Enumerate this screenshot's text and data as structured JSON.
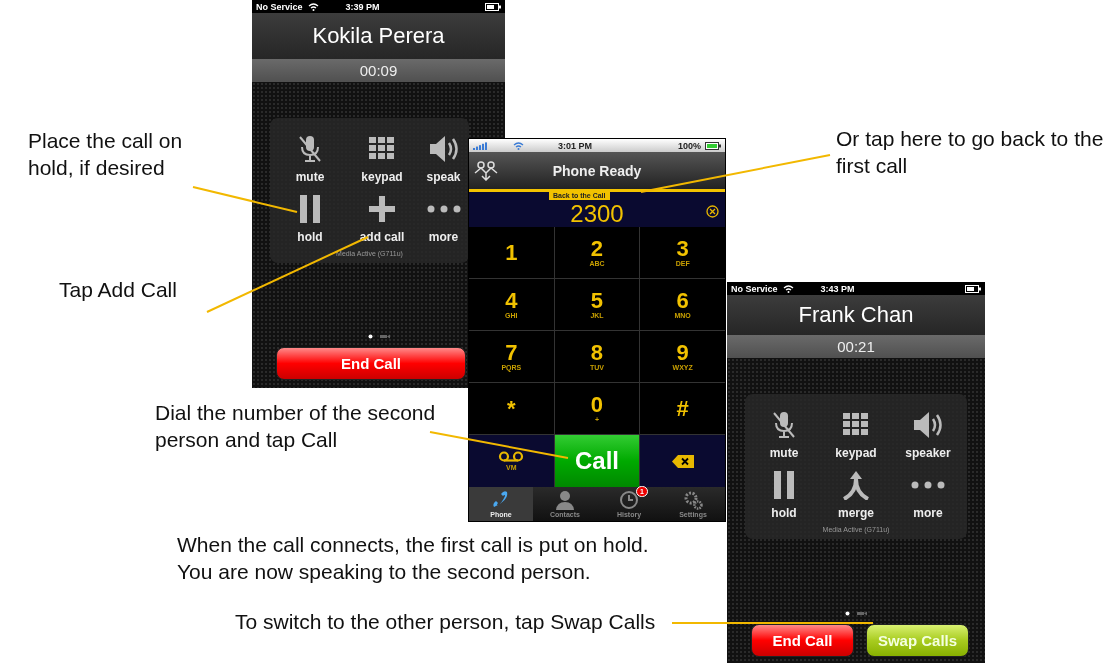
{
  "call_screen_first": {
    "carrier": "No Service",
    "time": "3:39 PM",
    "caller": "Kokila Perera",
    "duration": "00:09",
    "controls": [
      {
        "kind": "mute",
        "label": "mute"
      },
      {
        "kind": "keypad",
        "label": "keypad"
      },
      {
        "kind": "speaker",
        "label": "speak"
      },
      {
        "kind": "hold",
        "label": "hold"
      },
      {
        "kind": "add",
        "label": "add call"
      },
      {
        "kind": "more",
        "label": "more"
      }
    ],
    "media": "Media Active (G711u)",
    "actions": [
      {
        "kind": "end",
        "label": "End Call"
      }
    ]
  },
  "dialer": {
    "time": "3:01 PM",
    "battery": "100%",
    "title": "Phone Ready",
    "banner": "Back to the Call",
    "number": "2300",
    "keys": [
      {
        "digit": "1"
      },
      {
        "digit": "2",
        "letters": "ABC"
      },
      {
        "digit": "3",
        "letters": "DEF"
      },
      {
        "digit": "4",
        "letters": "GHI"
      },
      {
        "digit": "5",
        "letters": "JKL"
      },
      {
        "digit": "6",
        "letters": "MNO"
      },
      {
        "digit": "7",
        "letters": "PQRS"
      },
      {
        "digit": "8",
        "letters": "TUV"
      },
      {
        "digit": "9",
        "letters": "WXYZ"
      },
      {
        "digit": "*"
      },
      {
        "digit": "0",
        "letters": "+"
      },
      {
        "digit": "#"
      }
    ],
    "bottom_row": [
      {
        "kind": "voicemail",
        "label": "VM"
      },
      {
        "kind": "call",
        "label": "Call"
      },
      {
        "kind": "backspace"
      }
    ],
    "tabs": [
      {
        "kind": "phone",
        "label": "Phone",
        "selected": true
      },
      {
        "kind": "contacts",
        "label": "Contacts",
        "selected": false
      },
      {
        "kind": "history",
        "label": "History",
        "selected": false,
        "badge": "1"
      },
      {
        "kind": "settings",
        "label": "Settings",
        "selected": false
      }
    ]
  },
  "call_screen_second": {
    "carrier": "No Service",
    "time": "3:43 PM",
    "caller": "Frank Chan",
    "duration": "00:21",
    "controls": [
      {
        "kind": "mute",
        "label": "mute"
      },
      {
        "kind": "keypad",
        "label": "keypad"
      },
      {
        "kind": "speaker",
        "label": "speaker"
      },
      {
        "kind": "hold",
        "label": "hold"
      },
      {
        "kind": "merge",
        "label": "merge"
      },
      {
        "kind": "more",
        "label": "more"
      }
    ],
    "media": "Media Active (G711u)",
    "actions": [
      {
        "kind": "end",
        "label": "End Call"
      },
      {
        "kind": "swap",
        "label": "Swap Calls"
      }
    ]
  },
  "callouts": [
    {
      "text": "Place the call on hold, if desired"
    },
    {
      "text": "Tap Add Call"
    },
    {
      "text": "Or tap here to go back to the first call"
    },
    {
      "text": "Dial the number of the second person and tap Call"
    },
    {
      "text": "When the call connects, the first call is put on hold. You are now speaking to the second person."
    },
    {
      "text": "To switch to the other person, tap Swap Calls"
    }
  ]
}
